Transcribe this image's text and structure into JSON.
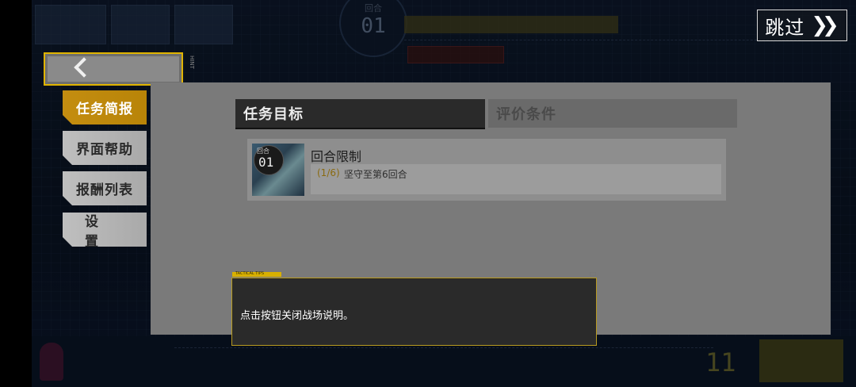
{
  "skip": {
    "label": "跳过",
    "icon": "double-chevron-right"
  },
  "back": {
    "icon": "chevron-left",
    "hint_label": "HINT"
  },
  "side_menu": {
    "items": [
      {
        "label": "任务简报",
        "active": true
      },
      {
        "label": "界面帮助",
        "active": false
      },
      {
        "label": "报酬列表",
        "active": false
      },
      {
        "label": "设置",
        "active": false
      }
    ]
  },
  "tabs": {
    "objective": "任务目标",
    "evaluation": "评价条件"
  },
  "objective_card": {
    "thumb_label": "回合",
    "thumb_number": "01",
    "title": "回合限制",
    "progress": "(1/6)",
    "description": "坚守至第6回合"
  },
  "tips": {
    "tag": "TACTICAL TIPS",
    "message": "点击按钮关闭战场说明。"
  },
  "hud": {
    "round_label": "回合",
    "round_number": "01",
    "bottom_number": "11"
  },
  "colors": {
    "accent_gold": "#c48d10",
    "tab_dark": "#2a2a2a",
    "panel_gray": "#7a7a7a"
  }
}
